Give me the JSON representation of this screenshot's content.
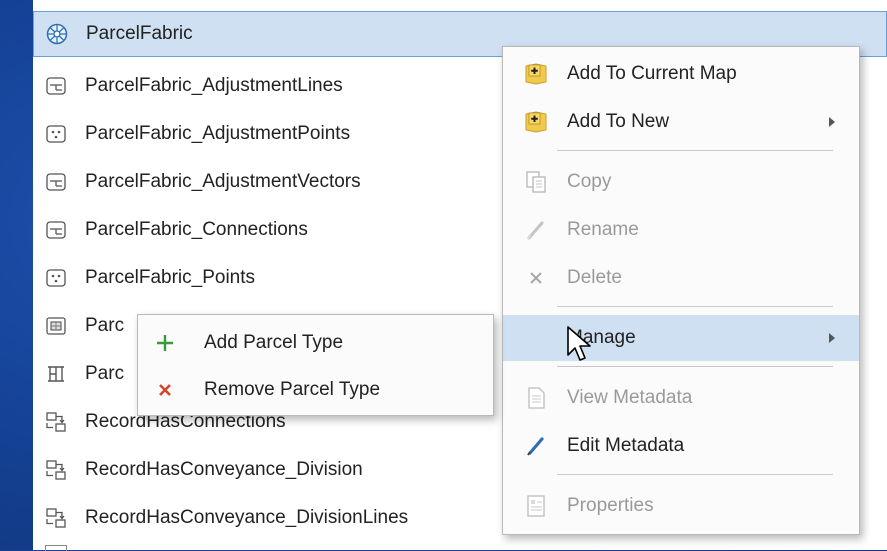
{
  "catalog": {
    "items": [
      {
        "label": "ParcelFabric",
        "icon": "parcel-fabric-icon",
        "selected": true
      },
      {
        "label": "ParcelFabric_AdjustmentLines",
        "icon": "line-feature-class-icon"
      },
      {
        "label": "ParcelFabric_AdjustmentPoints",
        "icon": "point-feature-class-icon"
      },
      {
        "label": "ParcelFabric_AdjustmentVectors",
        "icon": "line-feature-class-icon"
      },
      {
        "label": "ParcelFabric_Connections",
        "icon": "line-feature-class-icon"
      },
      {
        "label": "ParcelFabric_Points",
        "icon": "point-feature-class-icon"
      },
      {
        "label": "Parc",
        "icon": "polygon-feature-class-icon"
      },
      {
        "label": "Parc",
        "icon": "topology-icon"
      },
      {
        "label": "RecordHasConnections",
        "icon": "relationship-class-icon"
      },
      {
        "label": "RecordHasConveyance_Division",
        "icon": "relationship-class-icon"
      },
      {
        "label": "RecordHasConveyance_DivisionLines",
        "icon": "relationship-class-icon"
      }
    ]
  },
  "context_menu": {
    "items": [
      {
        "label": "Add To Current Map",
        "icon": "add-to-map-icon",
        "disabled": false
      },
      {
        "label": "Add To New",
        "icon": "add-to-new-icon",
        "disabled": false,
        "submenu": true
      },
      {
        "label": "Copy",
        "icon": "copy-icon",
        "disabled": true
      },
      {
        "label": "Rename",
        "icon": "rename-icon",
        "disabled": true
      },
      {
        "label": "Delete",
        "icon": "delete-icon",
        "disabled": true
      },
      {
        "label": "Manage",
        "icon": "",
        "disabled": false,
        "submenu": true,
        "highlighted": true
      },
      {
        "label": "View Metadata",
        "icon": "view-metadata-icon",
        "disabled": true
      },
      {
        "label": "Edit Metadata",
        "icon": "edit-metadata-icon",
        "disabled": false
      },
      {
        "label": "Properties",
        "icon": "properties-icon",
        "disabled": true
      }
    ]
  },
  "submenu": {
    "items": [
      {
        "label": "Add Parcel Type",
        "icon": "plus-icon"
      },
      {
        "label": "Remove Parcel Type",
        "icon": "remove-x-icon"
      }
    ]
  },
  "colors": {
    "background": "#16449a",
    "selection": "#cfe0f2",
    "selection_border": "#6c9ed6",
    "plus_green": "#3a9a3a",
    "remove_red": "#d0462c",
    "map_yellow": "#f2c94c"
  }
}
